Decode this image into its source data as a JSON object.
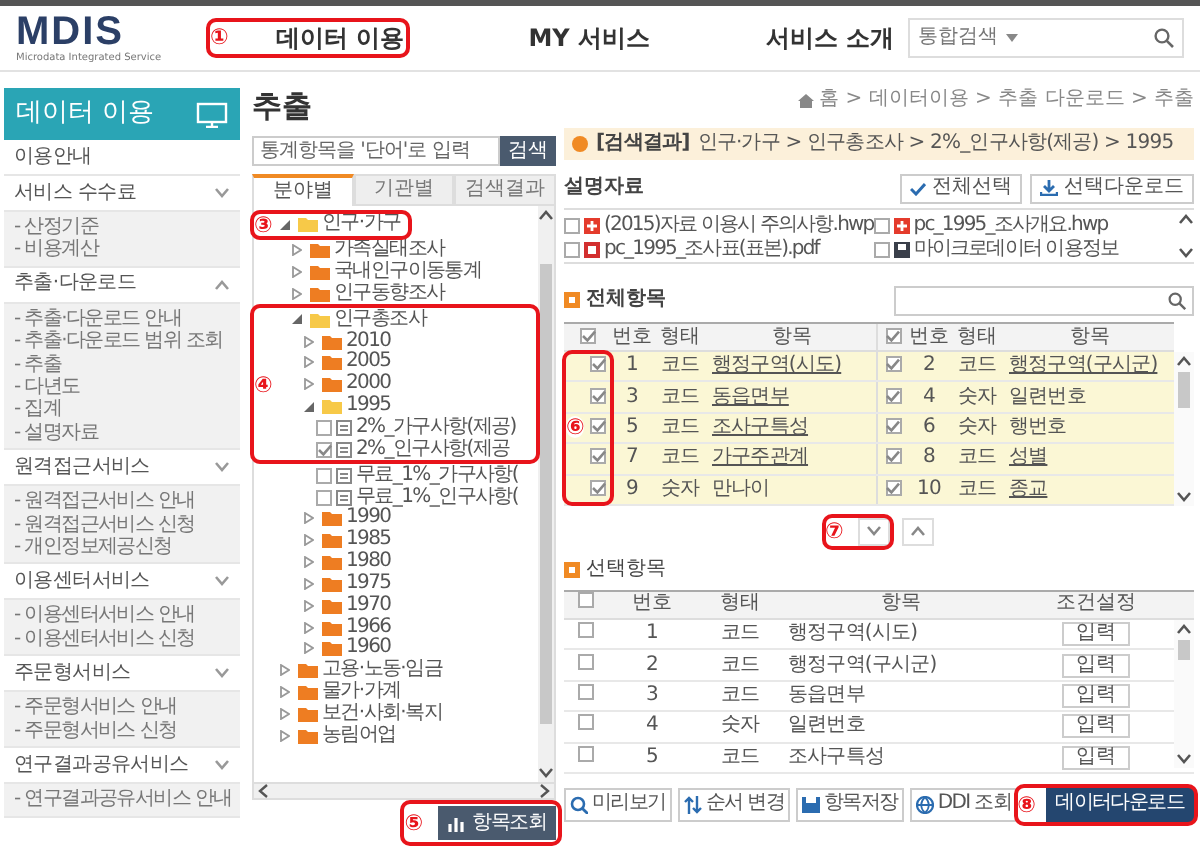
{
  "header": {
    "logo": "MDIS",
    "logo_tagline": "Microdata Integrated Service",
    "nav": [
      {
        "label": "데이터 이용",
        "callout": "①"
      },
      {
        "label": "MY 서비스"
      },
      {
        "label": "서비스 소개"
      }
    ],
    "search_scope": "통합검색"
  },
  "sidebar": {
    "title": "데이터 이용",
    "items": [
      {
        "label": "이용안내"
      },
      {
        "label": "서비스 수수료",
        "expanded": false,
        "children": [
          "- 산정기준",
          "- 비용계산"
        ]
      },
      {
        "label": "추출·다운로드",
        "expanded": true,
        "children": [
          "- 추출·다운로드 안내",
          "- 추출·다운로드 범위 조회",
          "- 추출",
          "- 다년도",
          "- 집계",
          "- 설명자료"
        ]
      },
      {
        "label": "원격접근서비스",
        "expanded": false,
        "children": [
          "- 원격접근서비스 안내",
          "- 원격접근서비스 신청",
          "- 개인정보제공신청"
        ]
      },
      {
        "label": "이용센터서비스",
        "expanded": false,
        "children": [
          "- 이용센터서비스 안내",
          "- 이용센터서비스 신청"
        ]
      },
      {
        "label": "주문형서비스",
        "expanded": false,
        "children": [
          "- 주문형서비스 안내",
          "- 주문형서비스 신청"
        ]
      },
      {
        "label": "연구결과공유서비스",
        "expanded": false,
        "children": [
          "- 연구결과공유서비스 안내"
        ]
      }
    ]
  },
  "page_title": "추출",
  "finder": {
    "placeholder": "통계항목을 '단어'로 입력",
    "search_button": "검색",
    "tabs": [
      {
        "label": "분야별",
        "selected": true
      },
      {
        "label": "기관별",
        "selected": false
      },
      {
        "label": "검색결과",
        "selected": false
      }
    ],
    "tree": [
      {
        "label": "인구·가구",
        "kind": "folder",
        "expanded": true,
        "callout": "③",
        "children": [
          {
            "label": "가족실태조사",
            "kind": "folder",
            "expanded": false
          },
          {
            "label": "국내인구이동통계",
            "kind": "folder",
            "expanded": false
          },
          {
            "label": "인구동향조사",
            "kind": "folder",
            "expanded": false
          },
          {
            "label": "인구총조사",
            "kind": "folder",
            "expanded": true,
            "callout": "④",
            "children": [
              {
                "label": "2010",
                "kind": "folder",
                "expanded": false
              },
              {
                "label": "2005",
                "kind": "folder",
                "expanded": false
              },
              {
                "label": "2000",
                "kind": "folder",
                "expanded": false
              },
              {
                "label": "1995",
                "kind": "folder",
                "expanded": true,
                "children": [
                  {
                    "label": "2%_가구사항(제공)",
                    "kind": "file",
                    "checked": false
                  },
                  {
                    "label": "2%_인구사항(제공",
                    "kind": "file",
                    "checked": true,
                    "callout_end": true
                  },
                  {
                    "label": "무료_1%_가구사항(",
                    "kind": "file",
                    "checked": false
                  },
                  {
                    "label": "무료_1%_인구사항(",
                    "kind": "file",
                    "checked": false
                  }
                ]
              },
              {
                "label": "1990",
                "kind": "folder",
                "expanded": false
              },
              {
                "label": "1985",
                "kind": "folder",
                "expanded": false
              },
              {
                "label": "1980",
                "kind": "folder",
                "expanded": false
              },
              {
                "label": "1975",
                "kind": "folder",
                "expanded": false
              },
              {
                "label": "1970",
                "kind": "folder",
                "expanded": false
              },
              {
                "label": "1966",
                "kind": "folder",
                "expanded": false
              },
              {
                "label": "1960",
                "kind": "folder",
                "expanded": false
              }
            ]
          }
        ]
      },
      {
        "label": "고용·노동·임금",
        "kind": "folder",
        "expanded": false
      },
      {
        "label": "물가·가계",
        "kind": "folder",
        "expanded": false
      },
      {
        "label": "보건·사회·복지",
        "kind": "folder",
        "expanded": false
      },
      {
        "label": "농림어업",
        "kind": "folder",
        "expanded": false
      }
    ],
    "submit": {
      "label": "항목조회",
      "callout": "⑤"
    }
  },
  "breadcrumb": "홈 > 데이터이용 > 추출 다운로드 > 추출",
  "result": {
    "label": "[검색결과]",
    "path": "인구·가구 > 인구총조사 > 2%_인구사항(제공) > 1995"
  },
  "explain": {
    "title": "설명자료",
    "select_all": "전체선택",
    "download": "선택다운로드",
    "files": [
      {
        "name": "(2015)자료 이용시 주의사항.hwp",
        "kind": "hwp",
        "checked": false
      },
      {
        "name": "pc_1995_조사개요.hwp",
        "kind": "hwp",
        "checked": false
      },
      {
        "name": "pc_1995_조사표(표본).pdf",
        "kind": "pdf",
        "checked": false
      },
      {
        "name": "마이크로데이터 이용정보",
        "kind": "doc",
        "checked": false
      }
    ]
  },
  "all_items": {
    "title": "전체항목",
    "columns": [
      "번호",
      "형태",
      "항목",
      "번호",
      "형태",
      "항목"
    ],
    "header_checked": true,
    "checkbox_callout": "⑥",
    "pager_callout": "⑦",
    "rows": [
      {
        "no": "1",
        "type": "코드",
        "name": "행정구역(시도)",
        "link": true,
        "checked": true
      },
      {
        "no": "2",
        "type": "코드",
        "name": "행정구역(구시군)",
        "link": true,
        "checked": true
      },
      {
        "no": "3",
        "type": "코드",
        "name": "동읍면부",
        "link": true,
        "checked": true
      },
      {
        "no": "4",
        "type": "숫자",
        "name": "일련번호",
        "link": false,
        "checked": true
      },
      {
        "no": "5",
        "type": "코드",
        "name": "조사구특성",
        "link": true,
        "checked": true
      },
      {
        "no": "6",
        "type": "숫자",
        "name": "행번호",
        "link": false,
        "checked": true
      },
      {
        "no": "7",
        "type": "코드",
        "name": "가구주관계",
        "link": true,
        "checked": true
      },
      {
        "no": "8",
        "type": "코드",
        "name": "성별",
        "link": true,
        "checked": true
      },
      {
        "no": "9",
        "type": "숫자",
        "name": "만나이",
        "link": false,
        "checked": true
      },
      {
        "no": "10",
        "type": "코드",
        "name": "종교",
        "link": true,
        "checked": true
      }
    ]
  },
  "selected_items": {
    "title": "선택항목",
    "columns": [
      "번호",
      "형태",
      "항목",
      "조건설정"
    ],
    "header_checked": false,
    "rows": [
      {
        "no": "1",
        "type": "코드",
        "name": "행정구역(시도)",
        "action": "입력",
        "checked": false
      },
      {
        "no": "2",
        "type": "코드",
        "name": "행정구역(구시군)",
        "action": "입력",
        "checked": false
      },
      {
        "no": "3",
        "type": "코드",
        "name": "동읍면부",
        "action": "입력",
        "checked": false
      },
      {
        "no": "4",
        "type": "숫자",
        "name": "일련번호",
        "action": "입력",
        "checked": false
      },
      {
        "no": "5",
        "type": "코드",
        "name": "조사구특성",
        "action": "입력",
        "checked": false
      }
    ]
  },
  "actions": [
    {
      "label": "미리보기",
      "kind": "search"
    },
    {
      "label": "순서 변경",
      "kind": "sort"
    },
    {
      "label": "항목저장",
      "kind": "save"
    },
    {
      "label": "DDI 조회",
      "kind": "globe"
    }
  ],
  "download": {
    "label": "데이터다운로드",
    "callout": "⑧"
  }
}
